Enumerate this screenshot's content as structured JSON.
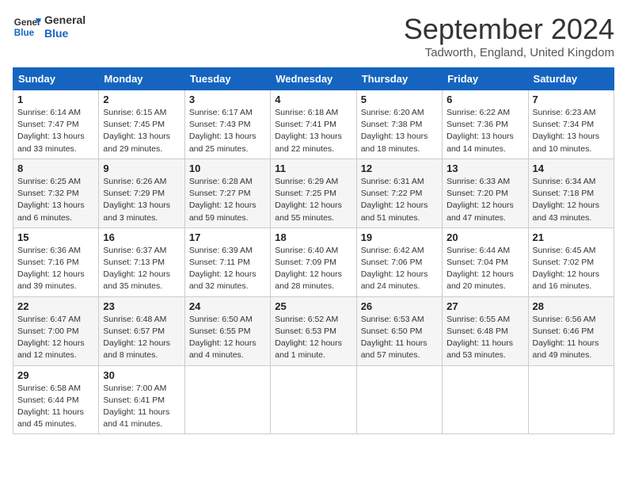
{
  "header": {
    "logo_line1": "General",
    "logo_line2": "Blue",
    "month": "September 2024",
    "location": "Tadworth, England, United Kingdom"
  },
  "days_of_week": [
    "Sunday",
    "Monday",
    "Tuesday",
    "Wednesday",
    "Thursday",
    "Friday",
    "Saturday"
  ],
  "weeks": [
    [
      {
        "day": "1",
        "detail": "Sunrise: 6:14 AM\nSunset: 7:47 PM\nDaylight: 13 hours\nand 33 minutes."
      },
      {
        "day": "2",
        "detail": "Sunrise: 6:15 AM\nSunset: 7:45 PM\nDaylight: 13 hours\nand 29 minutes."
      },
      {
        "day": "3",
        "detail": "Sunrise: 6:17 AM\nSunset: 7:43 PM\nDaylight: 13 hours\nand 25 minutes."
      },
      {
        "day": "4",
        "detail": "Sunrise: 6:18 AM\nSunset: 7:41 PM\nDaylight: 13 hours\nand 22 minutes."
      },
      {
        "day": "5",
        "detail": "Sunrise: 6:20 AM\nSunset: 7:38 PM\nDaylight: 13 hours\nand 18 minutes."
      },
      {
        "day": "6",
        "detail": "Sunrise: 6:22 AM\nSunset: 7:36 PM\nDaylight: 13 hours\nand 14 minutes."
      },
      {
        "day": "7",
        "detail": "Sunrise: 6:23 AM\nSunset: 7:34 PM\nDaylight: 13 hours\nand 10 minutes."
      }
    ],
    [
      {
        "day": "8",
        "detail": "Sunrise: 6:25 AM\nSunset: 7:32 PM\nDaylight: 13 hours\nand 6 minutes."
      },
      {
        "day": "9",
        "detail": "Sunrise: 6:26 AM\nSunset: 7:29 PM\nDaylight: 13 hours\nand 3 minutes."
      },
      {
        "day": "10",
        "detail": "Sunrise: 6:28 AM\nSunset: 7:27 PM\nDaylight: 12 hours\nand 59 minutes."
      },
      {
        "day": "11",
        "detail": "Sunrise: 6:29 AM\nSunset: 7:25 PM\nDaylight: 12 hours\nand 55 minutes."
      },
      {
        "day": "12",
        "detail": "Sunrise: 6:31 AM\nSunset: 7:22 PM\nDaylight: 12 hours\nand 51 minutes."
      },
      {
        "day": "13",
        "detail": "Sunrise: 6:33 AM\nSunset: 7:20 PM\nDaylight: 12 hours\nand 47 minutes."
      },
      {
        "day": "14",
        "detail": "Sunrise: 6:34 AM\nSunset: 7:18 PM\nDaylight: 12 hours\nand 43 minutes."
      }
    ],
    [
      {
        "day": "15",
        "detail": "Sunrise: 6:36 AM\nSunset: 7:16 PM\nDaylight: 12 hours\nand 39 minutes."
      },
      {
        "day": "16",
        "detail": "Sunrise: 6:37 AM\nSunset: 7:13 PM\nDaylight: 12 hours\nand 35 minutes."
      },
      {
        "day": "17",
        "detail": "Sunrise: 6:39 AM\nSunset: 7:11 PM\nDaylight: 12 hours\nand 32 minutes."
      },
      {
        "day": "18",
        "detail": "Sunrise: 6:40 AM\nSunset: 7:09 PM\nDaylight: 12 hours\nand 28 minutes."
      },
      {
        "day": "19",
        "detail": "Sunrise: 6:42 AM\nSunset: 7:06 PM\nDaylight: 12 hours\nand 24 minutes."
      },
      {
        "day": "20",
        "detail": "Sunrise: 6:44 AM\nSunset: 7:04 PM\nDaylight: 12 hours\nand 20 minutes."
      },
      {
        "day": "21",
        "detail": "Sunrise: 6:45 AM\nSunset: 7:02 PM\nDaylight: 12 hours\nand 16 minutes."
      }
    ],
    [
      {
        "day": "22",
        "detail": "Sunrise: 6:47 AM\nSunset: 7:00 PM\nDaylight: 12 hours\nand 12 minutes."
      },
      {
        "day": "23",
        "detail": "Sunrise: 6:48 AM\nSunset: 6:57 PM\nDaylight: 12 hours\nand 8 minutes."
      },
      {
        "day": "24",
        "detail": "Sunrise: 6:50 AM\nSunset: 6:55 PM\nDaylight: 12 hours\nand 4 minutes."
      },
      {
        "day": "25",
        "detail": "Sunrise: 6:52 AM\nSunset: 6:53 PM\nDaylight: 12 hours\nand 1 minute."
      },
      {
        "day": "26",
        "detail": "Sunrise: 6:53 AM\nSunset: 6:50 PM\nDaylight: 11 hours\nand 57 minutes."
      },
      {
        "day": "27",
        "detail": "Sunrise: 6:55 AM\nSunset: 6:48 PM\nDaylight: 11 hours\nand 53 minutes."
      },
      {
        "day": "28",
        "detail": "Sunrise: 6:56 AM\nSunset: 6:46 PM\nDaylight: 11 hours\nand 49 minutes."
      }
    ],
    [
      {
        "day": "29",
        "detail": "Sunrise: 6:58 AM\nSunset: 6:44 PM\nDaylight: 11 hours\nand 45 minutes."
      },
      {
        "day": "30",
        "detail": "Sunrise: 7:00 AM\nSunset: 6:41 PM\nDaylight: 11 hours\nand 41 minutes."
      },
      {
        "day": "",
        "detail": ""
      },
      {
        "day": "",
        "detail": ""
      },
      {
        "day": "",
        "detail": ""
      },
      {
        "day": "",
        "detail": ""
      },
      {
        "day": "",
        "detail": ""
      }
    ]
  ]
}
